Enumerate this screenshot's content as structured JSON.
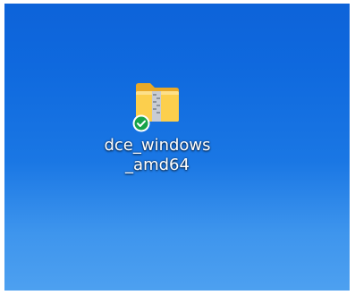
{
  "desktop": {
    "background_colors": [
      "#0d63d9",
      "#1a77e4",
      "#4da0f0"
    ],
    "icons": [
      {
        "icon": "zip-folder-icon",
        "status_icon": "sync-check-icon",
        "label_line1": "dce_windows",
        "label_line2": "_amd64"
      }
    ]
  }
}
